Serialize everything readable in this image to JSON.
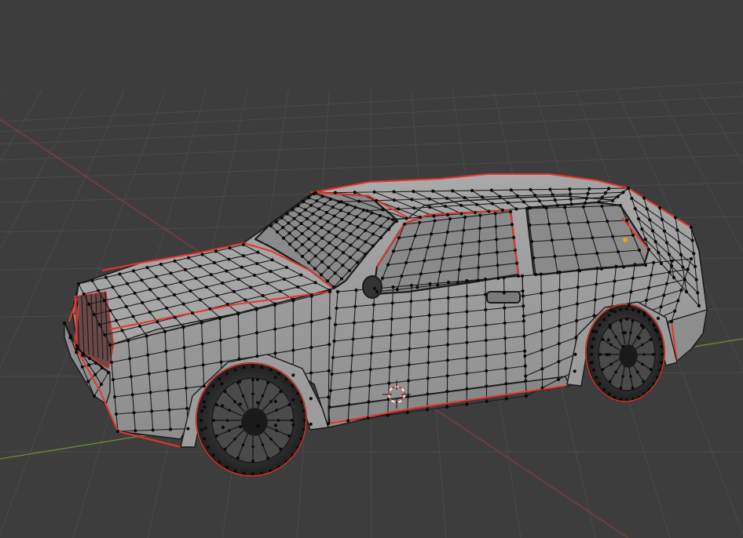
{
  "viewport": {
    "mode": "3d-viewport-edit-mode",
    "object": "hatchback-car-mesh",
    "selection": "seam-edges-marked"
  },
  "colors": {
    "background": "#3d3d3d",
    "grid_line": "#4a4a4a",
    "x_axis": "#8a3a3e",
    "y_axis": "#6a8c3a",
    "mesh_fill": "#9e9e9e",
    "mesh_fill_dark": "#7f7f7f",
    "wire": "#1a1a1a",
    "vertex": "#0a0a0a",
    "seam": "#e8342c",
    "tire": "#2a2a2a",
    "window": "#8a8a8a",
    "cursor_ring_white": "#f2f2f2",
    "cursor_ring_red": "#e0402a",
    "origin_dot": "#f2a020"
  },
  "icons": {
    "cursor": "3d-cursor-icon",
    "origin": "object-origin-icon"
  }
}
